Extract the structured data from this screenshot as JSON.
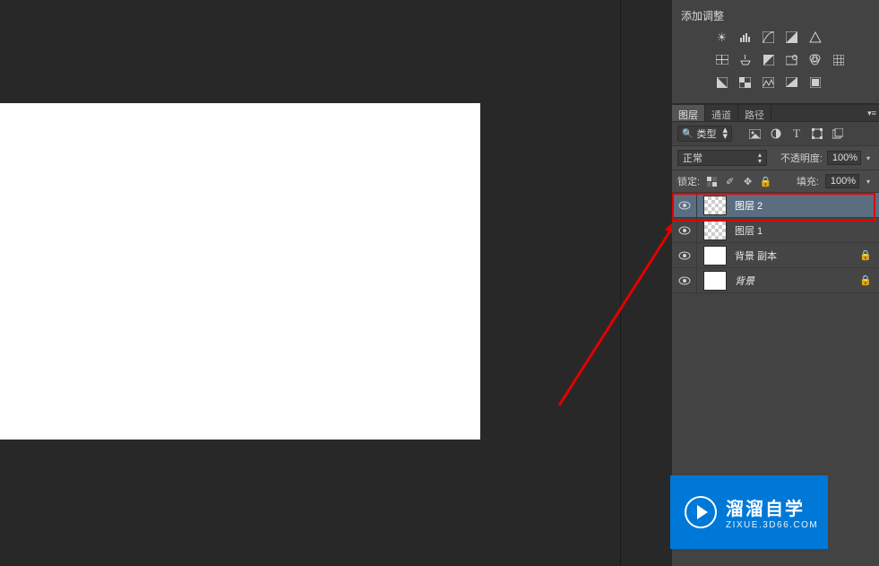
{
  "adjustments": {
    "title": "添加调整"
  },
  "tabs": {
    "layers": "图层",
    "channels": "通道",
    "paths": "路径"
  },
  "filter": {
    "type_label": "类型"
  },
  "blend": {
    "mode": "正常",
    "opacity_label": "不透明度:",
    "opacity_value": "100%"
  },
  "lock": {
    "label": "锁定:",
    "fill_label": "填充:",
    "fill_value": "100%"
  },
  "layers": [
    {
      "name": "图层 2",
      "selected": true,
      "transparent": true,
      "locked": false,
      "italic": false
    },
    {
      "name": "图层 1",
      "selected": false,
      "transparent": true,
      "locked": false,
      "italic": false
    },
    {
      "name": "背景 副本",
      "selected": false,
      "transparent": false,
      "locked": true,
      "italic": false
    },
    {
      "name": "背景",
      "selected": false,
      "transparent": false,
      "locked": true,
      "italic": true
    }
  ],
  "watermark": {
    "title": "溜溜自学",
    "url": "ZIXUE.3D66.COM"
  }
}
